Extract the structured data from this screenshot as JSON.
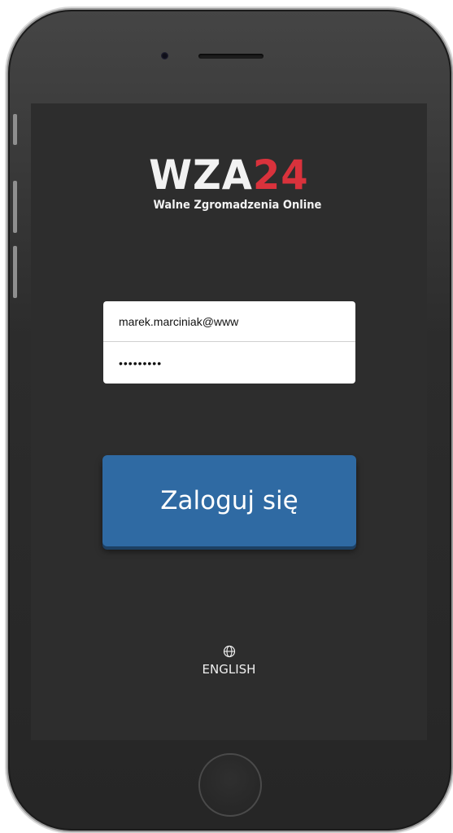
{
  "logo": {
    "brand_main": "WZA",
    "brand_number": "24",
    "tagline": "Walne Zgromadzenia Online"
  },
  "login_form": {
    "email_value": "marek.marciniak@www",
    "password_value": "•••••••••",
    "submit_label": "Zaloguj się"
  },
  "language": {
    "label": "ENGLISH",
    "icon": "globe-icon"
  },
  "colors": {
    "screen_background": "#2d2d2d",
    "button_blue": "#2f6aa3",
    "brand_red": "#d9323c"
  }
}
